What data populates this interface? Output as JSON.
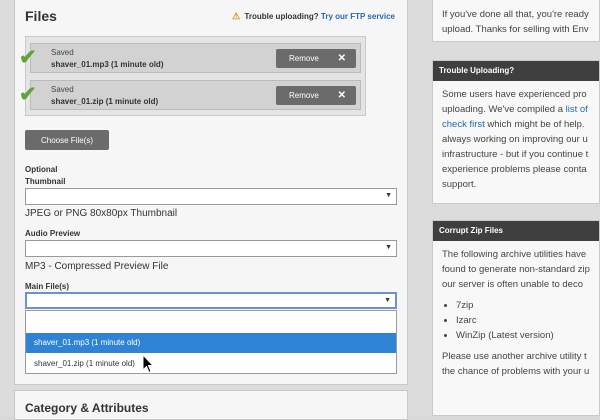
{
  "files": {
    "title": "Files",
    "trouble_text": "Trouble uploading?",
    "trouble_link": "Try our FTP service",
    "uploads": [
      {
        "status": "Saved",
        "name": "shaver_01.mp3 (1 minute old)",
        "remove_label": "Remove"
      },
      {
        "status": "Saved",
        "name": "shaver_01.zip (1 minute old)",
        "remove_label": "Remove"
      }
    ],
    "choose_label": "Choose File(s)",
    "thumbnail": {
      "label_line1": "Optional",
      "label_line2": "Thumbnail",
      "help": "JPEG or PNG 80x80px Thumbnail"
    },
    "audio_preview": {
      "label": "Audio Preview",
      "help": "MP3 - Compressed Preview File"
    },
    "main_files": {
      "label": "Main File(s)",
      "options": [
        "shaver_01.mp3 (1 minute old)",
        "shaver_01.zip (1 minute old)"
      ]
    }
  },
  "category": {
    "title": "Category & Attributes"
  },
  "sidebar": {
    "top_box": {
      "line1": "If you've done all that, you're ready",
      "line2": "upload. Thanks for selling with Env"
    },
    "trouble_box": {
      "title": "Trouble Uploading?",
      "l1": "Some users have experienced pro",
      "l2": "uploading. We've compiled a ",
      "l2_link": "list of",
      "l3_link": "check first",
      "l3": " which might be of help.",
      "l4": "always working on improving our u",
      "l5": "infrastructure - but if you continue t",
      "l6": "experience problems please conta",
      "l7": "support."
    },
    "corrupt_box": {
      "title": "Corrupt Zip Files",
      "l1": "The following archive utilities have",
      "l2": "found to generate non-standard zip",
      "l3": "our server is often unable to deco",
      "items": [
        "7zip",
        "Izarc",
        "WinZip (Latest version)"
      ],
      "l4": "Please use another archive utility t",
      "l5": "the chance of problems with your u"
    }
  }
}
